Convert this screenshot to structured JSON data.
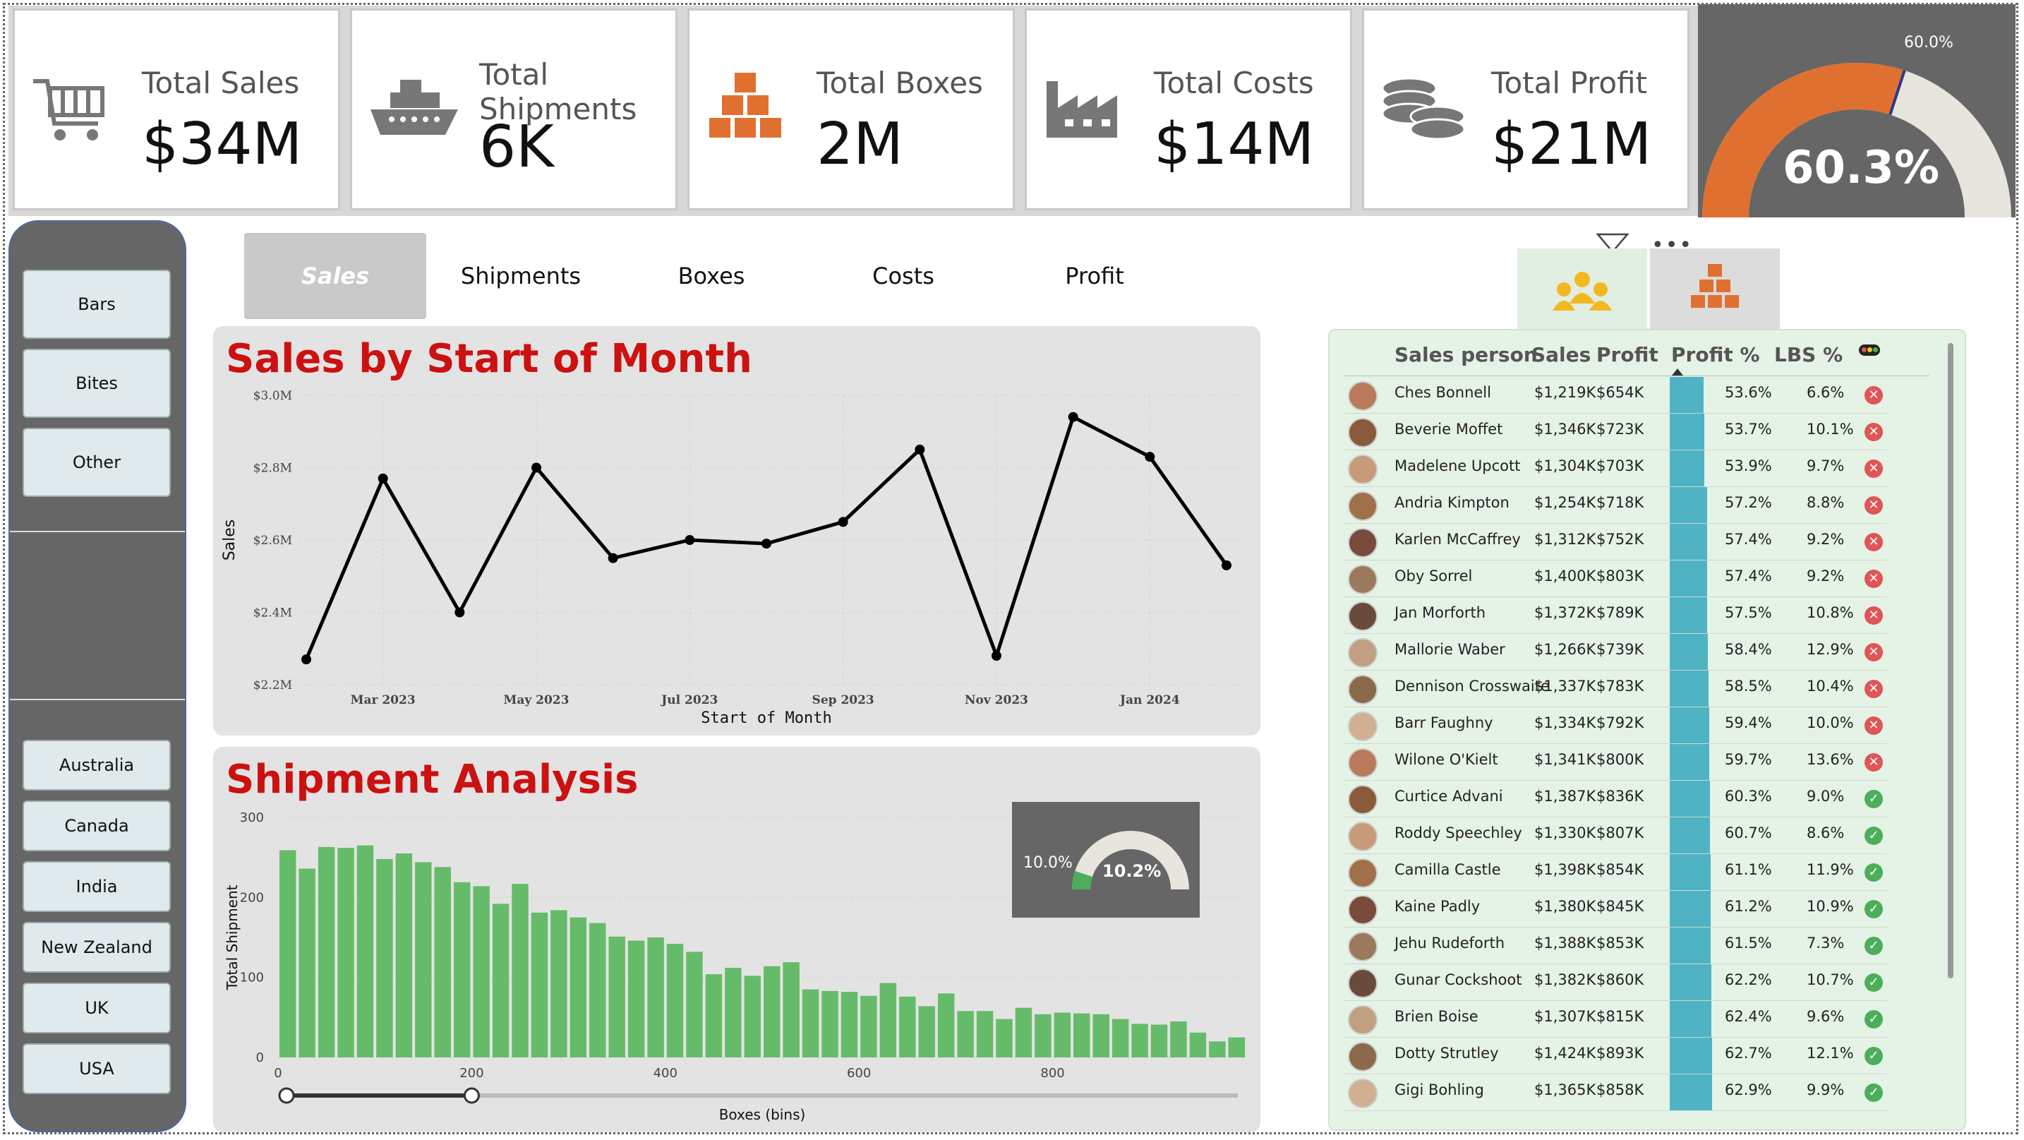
{
  "kpis": [
    {
      "label": "Total Sales",
      "value": "$34M",
      "icon": "cart-icon"
    },
    {
      "label": "Total Shipments",
      "value": "6K",
      "icon": "ship-icon"
    },
    {
      "label": "Total Boxes",
      "value": "2M",
      "icon": "boxes-icon"
    },
    {
      "label": "Total Costs",
      "value": "$14M",
      "icon": "factory-icon"
    },
    {
      "label": "Total Profit",
      "value": "$21M",
      "icon": "coins-icon"
    }
  ],
  "profit_gauge": {
    "value": "60.3%",
    "target": "60.0%",
    "fraction": 0.603,
    "color": "#e07030"
  },
  "sidebar": {
    "products": [
      "Bars",
      "Bites",
      "Other"
    ],
    "countries": [
      "Australia",
      "Canada",
      "India",
      "New Zealand",
      "UK",
      "USA"
    ]
  },
  "tabs": [
    "Sales",
    "Shipments",
    "Boxes",
    "Costs",
    "Profit"
  ],
  "active_tab": "Sales",
  "sales_chart": {
    "title": "Sales by Start of Month",
    "chart_data": {
      "type": "line",
      "title": "Sales by Start of Month",
      "xlabel": "Start of Month",
      "ylabel": "Sales",
      "ylim": [
        2.2,
        3.0
      ],
      "y_ticks": [
        "$3.0M",
        "$2.8M",
        "$2.6M",
        "$2.4M",
        "$2.2M"
      ],
      "x_ticks": [
        "Mar 2023",
        "May 2023",
        "Jul 2023",
        "Sep 2023",
        "Nov 2023",
        "Jan 2024"
      ],
      "x": [
        "Feb 2023",
        "Mar 2023",
        "Apr 2023",
        "May 2023",
        "Jun 2023",
        "Jul 2023",
        "Aug 2023",
        "Sep 2023",
        "Oct 2023",
        "Nov 2023",
        "Dec 2023",
        "Jan 2024",
        "Feb 2024"
      ],
      "values": [
        2.27,
        2.77,
        2.4,
        2.8,
        2.55,
        2.6,
        2.59,
        2.65,
        2.85,
        2.28,
        2.94,
        2.83,
        2.53
      ]
    }
  },
  "shipment_chart": {
    "title": "Shipment Analysis",
    "gauge": {
      "target": "10.0%",
      "value": "10.2%",
      "fraction": 0.102
    },
    "chart_data": {
      "type": "bar",
      "title": "Shipment Analysis",
      "xlabel": "Boxes (bins)",
      "ylabel": "Total Shipment",
      "ylim": [
        0,
        300
      ],
      "y_ticks": [
        "300",
        "200",
        "100",
        "0"
      ],
      "x_ticks": [
        "0",
        "200",
        "400",
        "600",
        "800"
      ],
      "bin_width": 20,
      "values": [
        259,
        236,
        263,
        262,
        265,
        248,
        255,
        244,
        238,
        219,
        214,
        192,
        217,
        181,
        184,
        175,
        168,
        151,
        146,
        150,
        142,
        132,
        104,
        112,
        102,
        114,
        119,
        85,
        83,
        82,
        77,
        93,
        76,
        64,
        80,
        58,
        58,
        48,
        62,
        54,
        56,
        55,
        54,
        48,
        42,
        41,
        45,
        31,
        20,
        25
      ]
    },
    "slider_labels": [
      "0",
      "200"
    ]
  },
  "sales_table": {
    "headers": [
      "Sales person",
      "Sales",
      "Profit",
      "Profit %",
      "LBS %"
    ],
    "rows": [
      {
        "name": "Ches Bonnell",
        "sales": "$1,219K",
        "profit": "$654K",
        "pct": "53.6%",
        "lbs": "6.6%",
        "status": "bad"
      },
      {
        "name": "Beverie Moffet",
        "sales": "$1,346K",
        "profit": "$723K",
        "pct": "53.7%",
        "lbs": "10.1%",
        "status": "bad"
      },
      {
        "name": "Madelene Upcott",
        "sales": "$1,304K",
        "profit": "$703K",
        "pct": "53.9%",
        "lbs": "9.7%",
        "status": "bad"
      },
      {
        "name": "Andria Kimpton",
        "sales": "$1,254K",
        "profit": "$718K",
        "pct": "57.2%",
        "lbs": "8.8%",
        "status": "bad"
      },
      {
        "name": "Karlen McCaffrey",
        "sales": "$1,312K",
        "profit": "$752K",
        "pct": "57.4%",
        "lbs": "9.2%",
        "status": "bad"
      },
      {
        "name": "Oby Sorrel",
        "sales": "$1,400K",
        "profit": "$803K",
        "pct": "57.4%",
        "lbs": "9.2%",
        "status": "bad"
      },
      {
        "name": "Jan Morforth",
        "sales": "$1,372K",
        "profit": "$789K",
        "pct": "57.5%",
        "lbs": "10.8%",
        "status": "bad"
      },
      {
        "name": "Mallorie Waber",
        "sales": "$1,266K",
        "profit": "$739K",
        "pct": "58.4%",
        "lbs": "12.9%",
        "status": "bad"
      },
      {
        "name": "Dennison Crosswaite",
        "sales": "$1,337K",
        "profit": "$783K",
        "pct": "58.5%",
        "lbs": "10.4%",
        "status": "bad"
      },
      {
        "name": "Barr Faughny",
        "sales": "$1,334K",
        "profit": "$792K",
        "pct": "59.4%",
        "lbs": "10.0%",
        "status": "bad"
      },
      {
        "name": "Wilone O'Kielt",
        "sales": "$1,341K",
        "profit": "$800K",
        "pct": "59.7%",
        "lbs": "13.6%",
        "status": "bad"
      },
      {
        "name": "Curtice Advani",
        "sales": "$1,387K",
        "profit": "$836K",
        "pct": "60.3%",
        "lbs": "9.0%",
        "status": "good"
      },
      {
        "name": "Roddy Speechley",
        "sales": "$1,330K",
        "profit": "$807K",
        "pct": "60.7%",
        "lbs": "8.6%",
        "status": "good"
      },
      {
        "name": "Camilla Castle",
        "sales": "$1,398K",
        "profit": "$854K",
        "pct": "61.1%",
        "lbs": "11.9%",
        "status": "good"
      },
      {
        "name": "Kaine Padly",
        "sales": "$1,380K",
        "profit": "$845K",
        "pct": "61.2%",
        "lbs": "10.9%",
        "status": "good"
      },
      {
        "name": "Jehu Rudeforth",
        "sales": "$1,388K",
        "profit": "$853K",
        "pct": "61.5%",
        "lbs": "7.3%",
        "status": "good"
      },
      {
        "name": "Gunar Cockshoot",
        "sales": "$1,382K",
        "profit": "$860K",
        "pct": "62.2%",
        "lbs": "10.7%",
        "status": "good"
      },
      {
        "name": "Brien Boise",
        "sales": "$1,307K",
        "profit": "$815K",
        "pct": "62.4%",
        "lbs": "9.6%",
        "status": "good"
      },
      {
        "name": "Dotty Strutley",
        "sales": "$1,424K",
        "profit": "$893K",
        "pct": "62.7%",
        "lbs": "12.1%",
        "status": "good"
      },
      {
        "name": "Gigi Bohling",
        "sales": "$1,365K",
        "profit": "$858K",
        "pct": "62.9%",
        "lbs": "9.9%",
        "status": "good"
      }
    ]
  },
  "colors": {
    "bad": "#e05555",
    "good": "#4cae5a",
    "bar": "#4fb3c4",
    "accent": "#e07030",
    "histogram": "#66bb6a",
    "title": "#cc1111"
  }
}
